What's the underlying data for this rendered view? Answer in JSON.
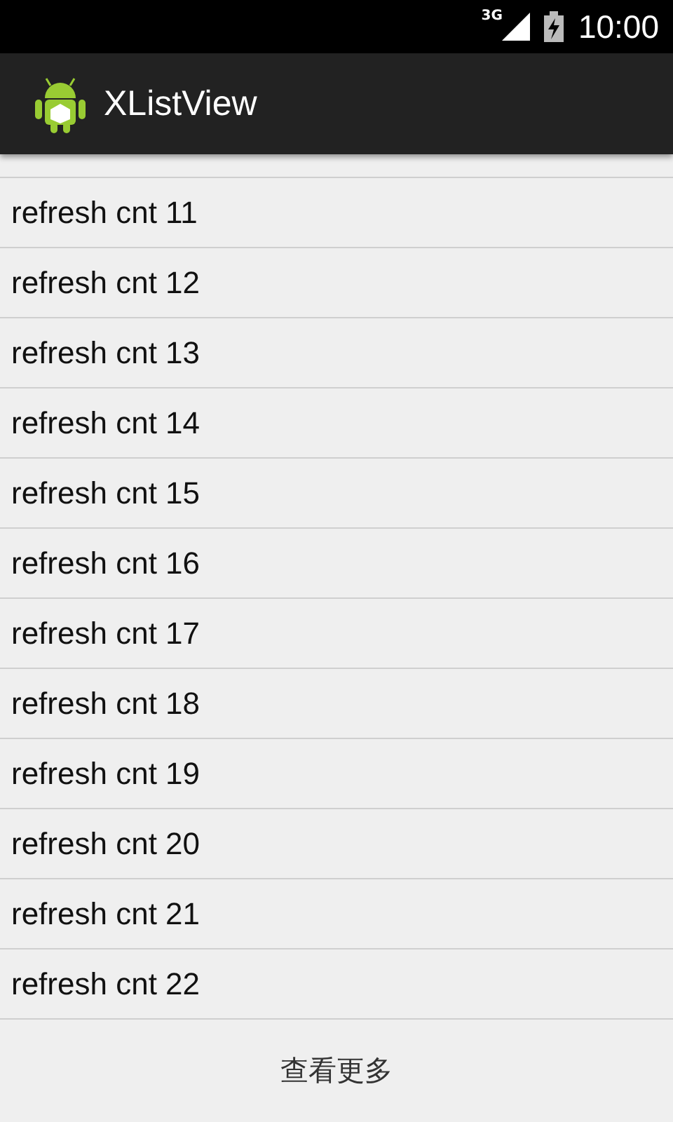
{
  "status_bar": {
    "network": "3G",
    "time": "10:00"
  },
  "action_bar": {
    "title": "XListView"
  },
  "list": {
    "items": [
      "refresh cnt 11",
      "refresh cnt 12",
      "refresh cnt 13",
      "refresh cnt 14",
      "refresh cnt 15",
      "refresh cnt 16",
      "refresh cnt 17",
      "refresh cnt 18",
      "refresh cnt 19",
      "refresh cnt 20",
      "refresh cnt 21",
      "refresh cnt 22"
    ]
  },
  "footer": {
    "label": "查看更多"
  }
}
